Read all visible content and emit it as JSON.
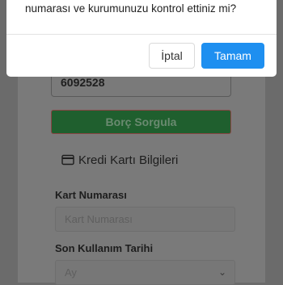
{
  "dialog": {
    "message": "numarası ve kurumunuzu kontrol ettiniz mi?",
    "cancel_label": "İptal",
    "ok_label": "Tamam"
  },
  "form": {
    "account_value": "6092528",
    "query_button": "Borç Sorgula",
    "section_icon": "credit-card-icon",
    "section_title": "Kredi Kartı Bilgileri",
    "card_number_label": "Kart Numarası",
    "card_number_placeholder": "Kart Numarası",
    "expiry_label": "Son Kullanım Tarihi",
    "month_selected": "Ay"
  },
  "colors": {
    "primary": "#1e8ff0",
    "query_button": "#1f5f2e"
  }
}
